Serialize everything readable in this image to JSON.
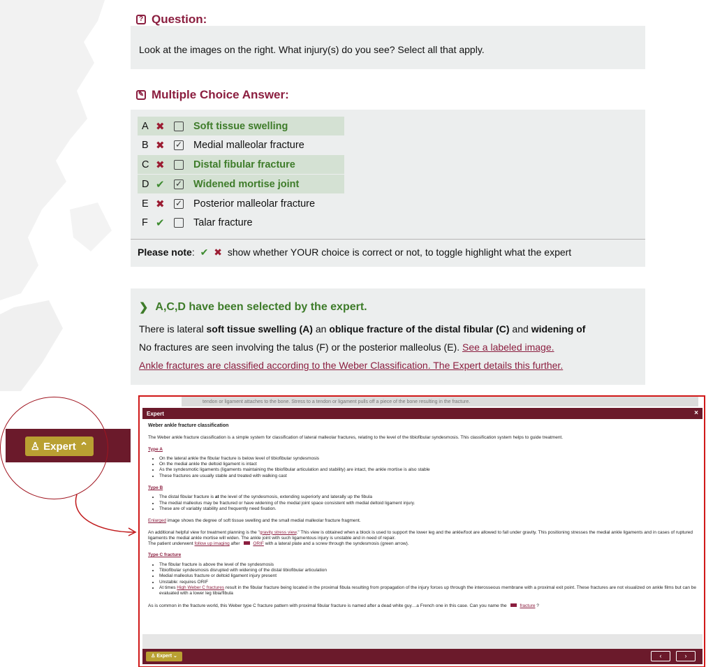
{
  "question": {
    "title": "Question:",
    "icon": "question-icon",
    "text": "Look at the images on the right. What injury(s) do you see? Select all that apply."
  },
  "answer": {
    "title": "Multiple Choice Answer:",
    "icon": "edit-icon",
    "options": [
      {
        "letter": "A",
        "mark": "✖",
        "checked": "",
        "label": "Soft tissue swelling",
        "expert": true
      },
      {
        "letter": "B",
        "mark": "✖",
        "checked": "✓",
        "label": "Medial malleolar fracture",
        "expert": false
      },
      {
        "letter": "C",
        "mark": "✖",
        "checked": "",
        "label": "Distal fibular fracture",
        "expert": true
      },
      {
        "letter": "D",
        "mark": "✔",
        "checked": "✓",
        "label": "Widened mortise joint",
        "expert": true
      },
      {
        "letter": "E",
        "mark": "✖",
        "checked": "✓",
        "label": "Posterior malleolar fracture",
        "expert": false
      },
      {
        "letter": "F",
        "mark": "✔",
        "checked": "",
        "label": "Talar fracture",
        "expert": false
      }
    ],
    "note_bold": "Please note",
    "note_text": "show whether YOUR choice is correct or not, to toggle highlight what the expert"
  },
  "explanation": {
    "title": "A,C,D have been selected by the expert.",
    "line1_a": "There is lateral ",
    "line1_b": "soft tissue swelling (A)",
    "line1_c": " an ",
    "line1_d": "oblique fracture of the distal fibular (C)",
    "line1_e": " and ",
    "line1_f": "widening of",
    "line2_text": "No fractures are seen involving the talus (F) or the posterior malleolus (E). ",
    "line2_link": "See a labeled image.",
    "line3_link": "Ankle fractures are classified according to the Weber Classification. The Expert details this further."
  },
  "sidebar": {
    "expert_label": "Expert",
    "expert_icon": "user-icon",
    "chevron": "chevron-up-icon"
  },
  "modal": {
    "ghost_text": "tendon or ligament attaches to the bone. Stress to a tendon or ligament pulls off a piece of the bone resulting in the fracture.",
    "header": "Expert",
    "close": "×",
    "heading": "Weber ankle fracture classification",
    "intro": "The Weber ankle fracture classification is a simple system for classification of lateral malleolar fractures, relating to the level of the tibiofibular syndesmosis. This classification system helps to guide treatment.",
    "type_a": "Type A",
    "type_a_items": [
      "On the lateral ankle the fibular fracture is below level of tibiofibular syndesmosis",
      "On the medial ankle the deltoid ligament is intact",
      "As the syndesmotic ligaments (ligaments maintaining the tibiofibular articulation and stability) are intact, the ankle mortise is also stable",
      "These fractures are usually stable and treated with walking cast"
    ],
    "type_b": "Type B",
    "type_b_item1_a": "The distal fibular fracture is ",
    "type_b_item1_b": "at",
    "type_b_item1_c": " the level of the syndesmosis, extending superiorly and laterally up the fibula",
    "type_b_item2": "The medial malleolus may be fractured or have widening of the medial joint space consistent with medial deltoid ligament injury.",
    "type_b_item3": "These are of variably stability  and frequently need fixation.",
    "enlarged_link": "Enlarged",
    "enlarged_text": " image shows the degree of soft tissue swelling and the small medial malleolar fracture fragment.",
    "gravity_a": "An additional helpful view for treatment planning is the \"",
    "gravity_link": "gravity stress view",
    "gravity_b": ".\" This view is obtained when a block is used to support the lower leg and the ankle/foot are allowed to fall under gravity. This positioning stresses the medial ankle ligaments and in cases of ruptured ligaments the medial ankle mortise will widen. The ankle joint with such ligamentous injury is unstable and in need of repair.",
    "patient_a": "The patient underwent ",
    "followup_link": "follow up imaging",
    "patient_b": " after ",
    "orif_link": "ORIF",
    "patient_c": " with a lateral plate and a screw through the syndesmosis (green arrow).",
    "type_c": "Type C fracture",
    "type_c_items": [
      "The fibular fracture is above the level of the syndesmosis",
      "Tibiofibular syndesmosis disrupted with widening of the distal tibiofibular articulation",
      "Medial malleolus fracture or deltoid ligament injury present",
      "Unstable: requires ORIF"
    ],
    "type_c_last_a": "At times ",
    "type_c_last_link": "High Weber C fractures",
    "type_c_last_b": " result in the fibular fracture being located in the proximal fibula resulting from propagation of the injury forces up through the interosseous membrane with a proximal exit point. These fractures are not visualized on ankle films but can be evaluated with a lower leg tibia/fibula",
    "closing_a": "As is common in the fracture world, this Weber type C fracture pattern with proximal fibular fracture is named after a dead white guy…a French one in this case. Can you name the ",
    "closing_link": "fracture",
    "closing_b": " ?",
    "footer_label": "Expert",
    "prev": "‹",
    "next": "›"
  },
  "colors": {
    "accent": "#8b1e3f",
    "green": "#3e7c2a",
    "panel": "#eceeee",
    "bar": "#6b1a2b",
    "gold": "#b9a032"
  }
}
